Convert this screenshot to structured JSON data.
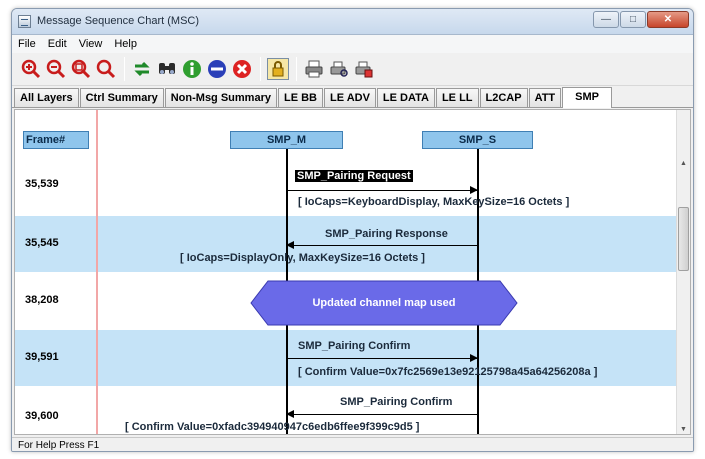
{
  "window": {
    "title": "Message Sequence Chart (MSC)"
  },
  "menu": [
    "File",
    "Edit",
    "View",
    "Help"
  ],
  "toolbar_icons": [
    "zoom-in-red-icon",
    "zoom-out-red-icon",
    "zoom-fit-red-icon",
    "zoom-reset-red-icon",
    "sync-icon",
    "find-icon",
    "info-icon",
    "stop-icon",
    "cancel-icon",
    "lock-icon",
    "print-icon",
    "print-preview-icon",
    "print-setup-icon"
  ],
  "tabs": [
    "All Layers",
    "Ctrl Summary",
    "Non-Msg Summary",
    "LE BB",
    "LE ADV",
    "LE DATA",
    "LE LL",
    "L2CAP",
    "ATT",
    "SMP"
  ],
  "active_tab": "SMP",
  "chart": {
    "frame_header": "Frame#",
    "lanes": [
      "SMP_M",
      "SMP_S"
    ],
    "rows": [
      {
        "frame": "35,539",
        "label": "SMP_Pairing Request",
        "detail": "[ IoCaps=KeyboardDisplay, MaxKeySize=16 Octets ]",
        "direction": "right",
        "shaded": false,
        "selected": true
      },
      {
        "frame": "35,545",
        "label": "SMP_Pairing Response",
        "detail": "[ IoCaps=DisplayOnly, MaxKeySize=16 Octets ]",
        "direction": "left",
        "shaded": true,
        "selected": false
      },
      {
        "frame": "38,208",
        "event": "Updated channel map used",
        "shaded": false
      },
      {
        "frame": "39,591",
        "label": "SMP_Pairing Confirm",
        "detail": "[ Confirm Value=0x7fc2569e13e92125798a45a64256208a ]",
        "direction": "right",
        "shaded": true,
        "selected": false
      },
      {
        "frame": "39,600",
        "label": "SMP_Pairing Confirm",
        "detail": "[ Confirm Value=0xfadc394940947c6edb6ffee9f399c9d5 ]",
        "direction": "left",
        "shaded": false,
        "selected": false
      }
    ]
  },
  "colors": {
    "lane_header": "#8fc5ec",
    "row_shade": "#c5e3f7",
    "event_fill": "#6a6ae8"
  },
  "status": "For Help Press F1"
}
